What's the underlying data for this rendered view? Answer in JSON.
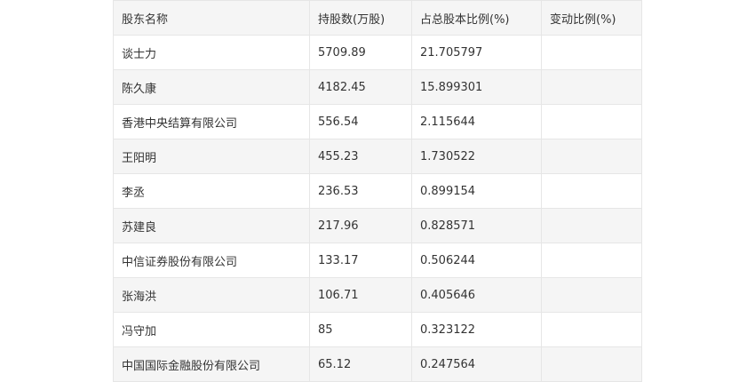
{
  "table": {
    "headers": [
      "股东名称",
      "持股数(万股)",
      "占总股本比例(%)",
      "变动比例(%)"
    ],
    "rows": [
      [
        "谈士力",
        "5709.89",
        "21.705797",
        ""
      ],
      [
        "陈久康",
        "4182.45",
        "15.899301",
        ""
      ],
      [
        "香港中央结算有限公司",
        "556.54",
        "2.115644",
        ""
      ],
      [
        "王阳明",
        "455.23",
        "1.730522",
        ""
      ],
      [
        "李丞",
        "236.53",
        "0.899154",
        ""
      ],
      [
        "苏建良",
        "217.96",
        "0.828571",
        ""
      ],
      [
        "中信证券股份有限公司",
        "133.17",
        "0.506244",
        ""
      ],
      [
        "张海洪",
        "106.71",
        "0.405646",
        ""
      ],
      [
        "冯守加",
        "85",
        "0.323122",
        ""
      ],
      [
        "中国国际金融股份有限公司",
        "65.12",
        "0.247564",
        ""
      ]
    ]
  }
}
